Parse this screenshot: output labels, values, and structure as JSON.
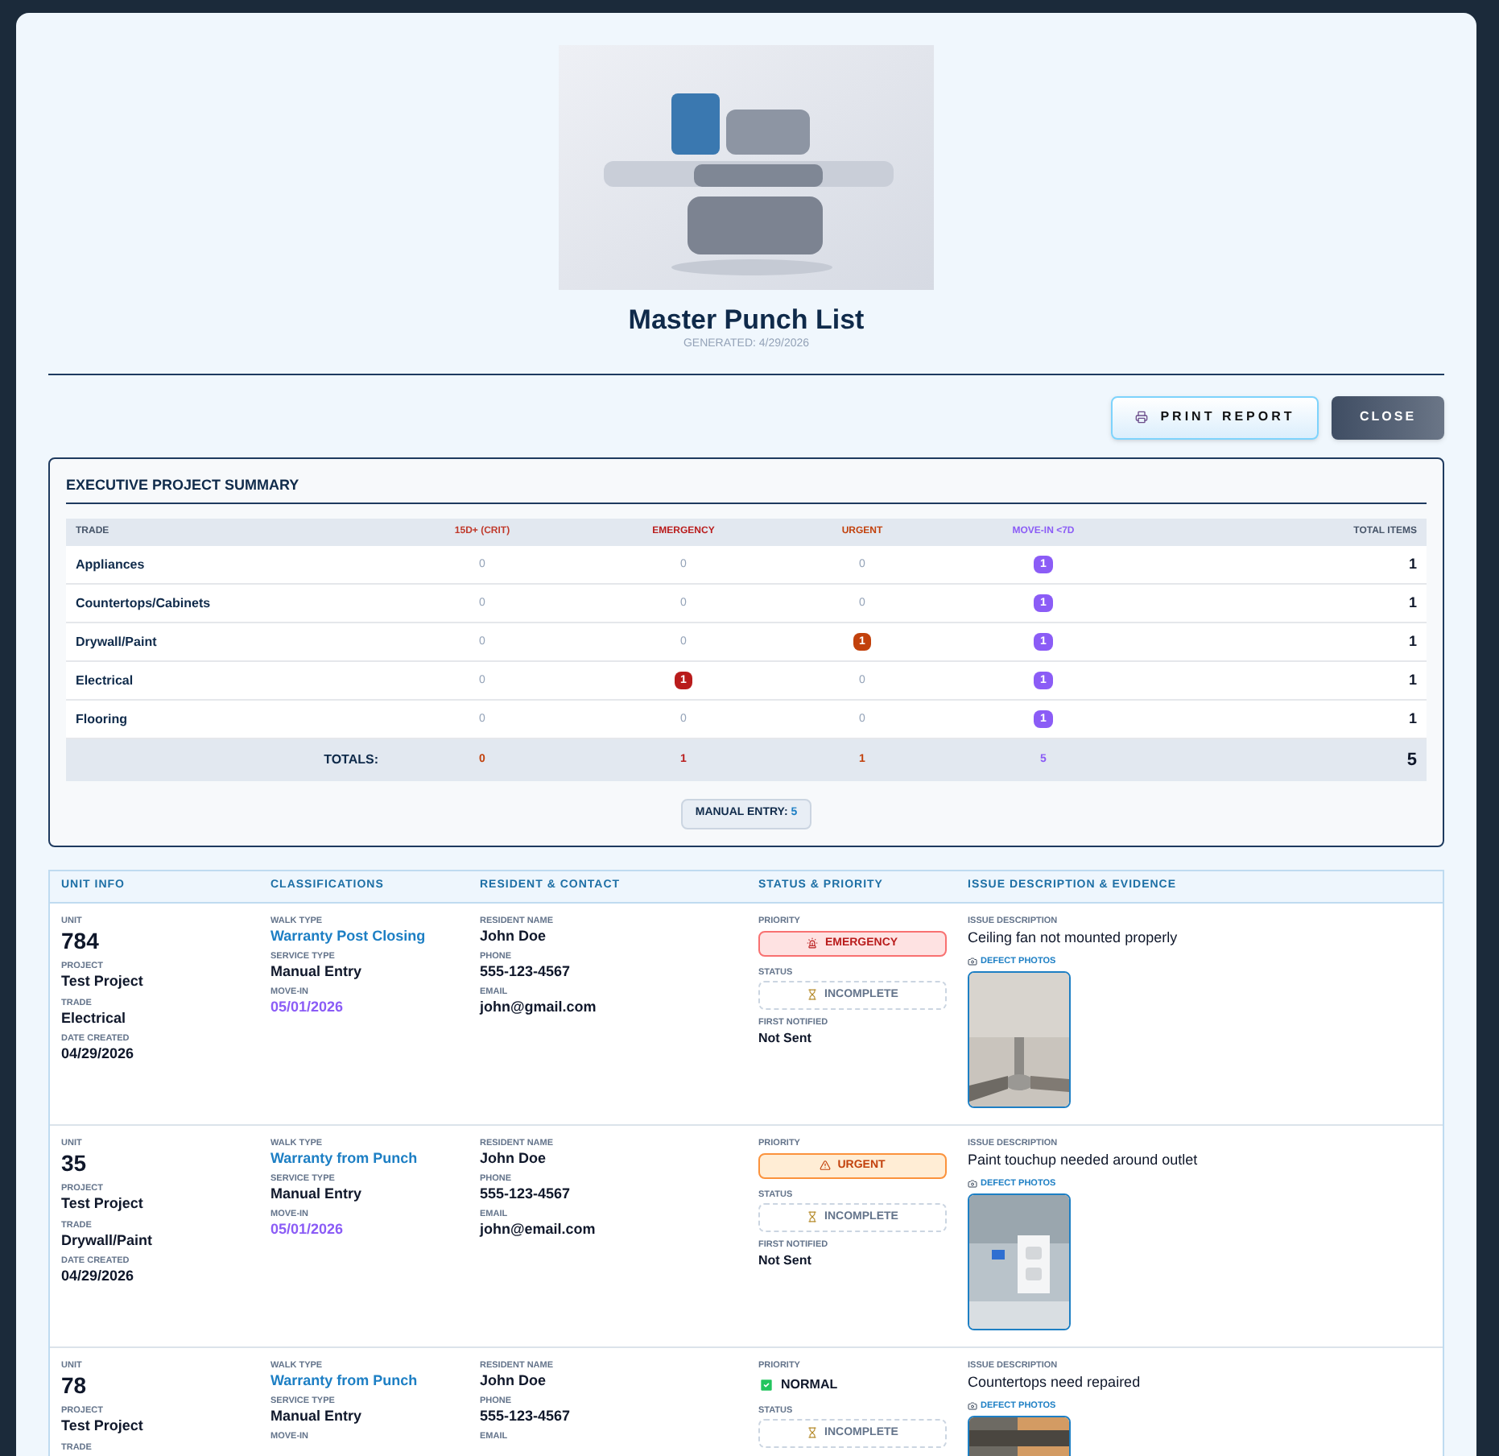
{
  "header": {
    "title": "Master Punch List",
    "generated": "GENERATED: 4/29/2026"
  },
  "buttons": [
    {
      "label": "PRINT REPORT",
      "kind": "print"
    },
    {
      "label": "CLOSE",
      "kind": "close"
    }
  ],
  "summary": {
    "title": "EXECUTIVE PROJECT SUMMARY",
    "columns": [
      {
        "label": "TRADE",
        "kind": "trade"
      },
      {
        "label": "15D+ (CRIT)",
        "kind": "crit"
      },
      {
        "label": "EMERGENCY",
        "kind": "emergency"
      },
      {
        "label": "URGENT",
        "kind": "urgent"
      },
      {
        "label": "MOVE-IN <7D",
        "kind": "movein"
      },
      {
        "label": "TOTAL ITEMS",
        "kind": "total"
      }
    ],
    "rows": [
      {
        "cells": [
          {
            "value": "Appliances"
          },
          {
            "value": "0",
            "flagged": false
          },
          {
            "value": "0",
            "flagged": false
          },
          {
            "value": "0",
            "flagged": false
          },
          {
            "value": "1",
            "flagged": true
          },
          {
            "value": "1"
          }
        ]
      },
      {
        "cells": [
          {
            "value": "Countertops/Cabinets"
          },
          {
            "value": "0",
            "flagged": false
          },
          {
            "value": "0",
            "flagged": false
          },
          {
            "value": "0",
            "flagged": false
          },
          {
            "value": "1",
            "flagged": true
          },
          {
            "value": "1"
          }
        ]
      },
      {
        "cells": [
          {
            "value": "Drywall/Paint"
          },
          {
            "value": "0",
            "flagged": false
          },
          {
            "value": "0",
            "flagged": false
          },
          {
            "value": "1",
            "flagged": true
          },
          {
            "value": "1",
            "flagged": true
          },
          {
            "value": "1"
          }
        ]
      },
      {
        "cells": [
          {
            "value": "Electrical"
          },
          {
            "value": "0",
            "flagged": false
          },
          {
            "value": "1",
            "flagged": true
          },
          {
            "value": "0",
            "flagged": false
          },
          {
            "value": "1",
            "flagged": true
          },
          {
            "value": "1"
          }
        ]
      },
      {
        "cells": [
          {
            "value": "Flooring"
          },
          {
            "value": "0",
            "flagged": false
          },
          {
            "value": "0",
            "flagged": false
          },
          {
            "value": "0",
            "flagged": false
          },
          {
            "value": "1",
            "flagged": true
          },
          {
            "value": "1"
          }
        ]
      }
    ],
    "totals": {
      "cells": [
        "TOTALS:",
        "0",
        "1",
        "1",
        "5",
        "5"
      ]
    },
    "manual_entry": {
      "label": "MANUAL ENTRY:",
      "value": "5"
    }
  },
  "issues": {
    "columns": [
      "UNIT INFO",
      "CLASSIFICATIONS",
      "RESIDENT & CONTACT",
      "STATUS & PRIORITY",
      "ISSUE DESCRIPTION & EVIDENCE"
    ],
    "rows": [
      {
        "unit_info": [
          {
            "label": "UNIT",
            "value": "784",
            "kind": "large"
          },
          {
            "label": "PROJECT",
            "value": "Test Project",
            "kind": "plain"
          },
          {
            "label": "TRADE",
            "value": "Electrical",
            "kind": "plain"
          },
          {
            "label": "DATE CREATED",
            "value": "04/29/2026",
            "kind": "plain"
          }
        ],
        "classifications": [
          {
            "label": "WALK TYPE",
            "value": "Warranty Post Closing",
            "kind": "link"
          },
          {
            "label": "SERVICE TYPE",
            "value": "Manual Entry",
            "kind": "plain"
          },
          {
            "label": "MOVE-IN",
            "value": "05/01/2026",
            "kind": "highlight"
          }
        ],
        "contact": [
          {
            "label": "RESIDENT NAME",
            "value": "John Doe",
            "kind": "plain"
          },
          {
            "label": "PHONE",
            "value": "555-123-4567",
            "kind": "plain"
          },
          {
            "label": "EMAIL",
            "value": "john@gmail.com",
            "kind": "plain"
          }
        ],
        "priority_label": "PRIORITY",
        "priority": {
          "kind": "emergency",
          "label": "EMERGENCY"
        },
        "status_label": "STATUS",
        "status": "INCOMPLETE",
        "notified_label": "FIRST NOTIFIED",
        "notified": "Not Sent",
        "issue_label": "ISSUE DESCRIPTION",
        "description": "Ceiling fan not mounted properly",
        "photos_label": "DEFECT PHOTOS"
      },
      {
        "unit_info": [
          {
            "label": "UNIT",
            "value": "35",
            "kind": "large"
          },
          {
            "label": "PROJECT",
            "value": "Test Project",
            "kind": "plain"
          },
          {
            "label": "TRADE",
            "value": "Drywall/Paint",
            "kind": "plain"
          },
          {
            "label": "DATE CREATED",
            "value": "04/29/2026",
            "kind": "plain"
          }
        ],
        "classifications": [
          {
            "label": "WALK TYPE",
            "value": "Warranty from Punch",
            "kind": "link"
          },
          {
            "label": "SERVICE TYPE",
            "value": "Manual Entry",
            "kind": "plain"
          },
          {
            "label": "MOVE-IN",
            "value": "05/01/2026",
            "kind": "highlight"
          }
        ],
        "contact": [
          {
            "label": "RESIDENT NAME",
            "value": "John Doe",
            "kind": "plain"
          },
          {
            "label": "PHONE",
            "value": "555-123-4567",
            "kind": "plain"
          },
          {
            "label": "EMAIL",
            "value": "john@email.com",
            "kind": "plain"
          }
        ],
        "priority_label": "PRIORITY",
        "priority": {
          "kind": "urgent",
          "label": "URGENT"
        },
        "status_label": "STATUS",
        "status": "INCOMPLETE",
        "notified_label": "FIRST NOTIFIED",
        "notified": "Not Sent",
        "issue_label": "ISSUE DESCRIPTION",
        "description": "Paint touchup needed around outlet",
        "photos_label": "DEFECT PHOTOS"
      },
      {
        "unit_info": [
          {
            "label": "UNIT",
            "value": "78",
            "kind": "large"
          },
          {
            "label": "PROJECT",
            "value": "Test Project",
            "kind": "plain"
          },
          {
            "label": "TRADE"
          }
        ],
        "classifications": [
          {
            "label": "WALK TYPE",
            "value": "Warranty from Punch",
            "kind": "link"
          },
          {
            "label": "SERVICE TYPE",
            "value": "Manual Entry",
            "kind": "plain"
          },
          {
            "label": "MOVE-IN"
          }
        ],
        "contact": [
          {
            "label": "RESIDENT NAME",
            "value": "John Doe",
            "kind": "plain"
          },
          {
            "label": "PHONE",
            "value": "555-123-4567",
            "kind": "plain"
          },
          {
            "label": "EMAIL"
          }
        ],
        "priority_label": "PRIORITY",
        "priority": {
          "kind": "normal",
          "label": "NORMAL"
        },
        "status_label": "STATUS",
        "status": "INCOMPLETE",
        "issue_label": "ISSUE DESCRIPTION",
        "description": "Countertops need repaired",
        "photos_label": "DEFECT PHOTOS"
      }
    ]
  }
}
